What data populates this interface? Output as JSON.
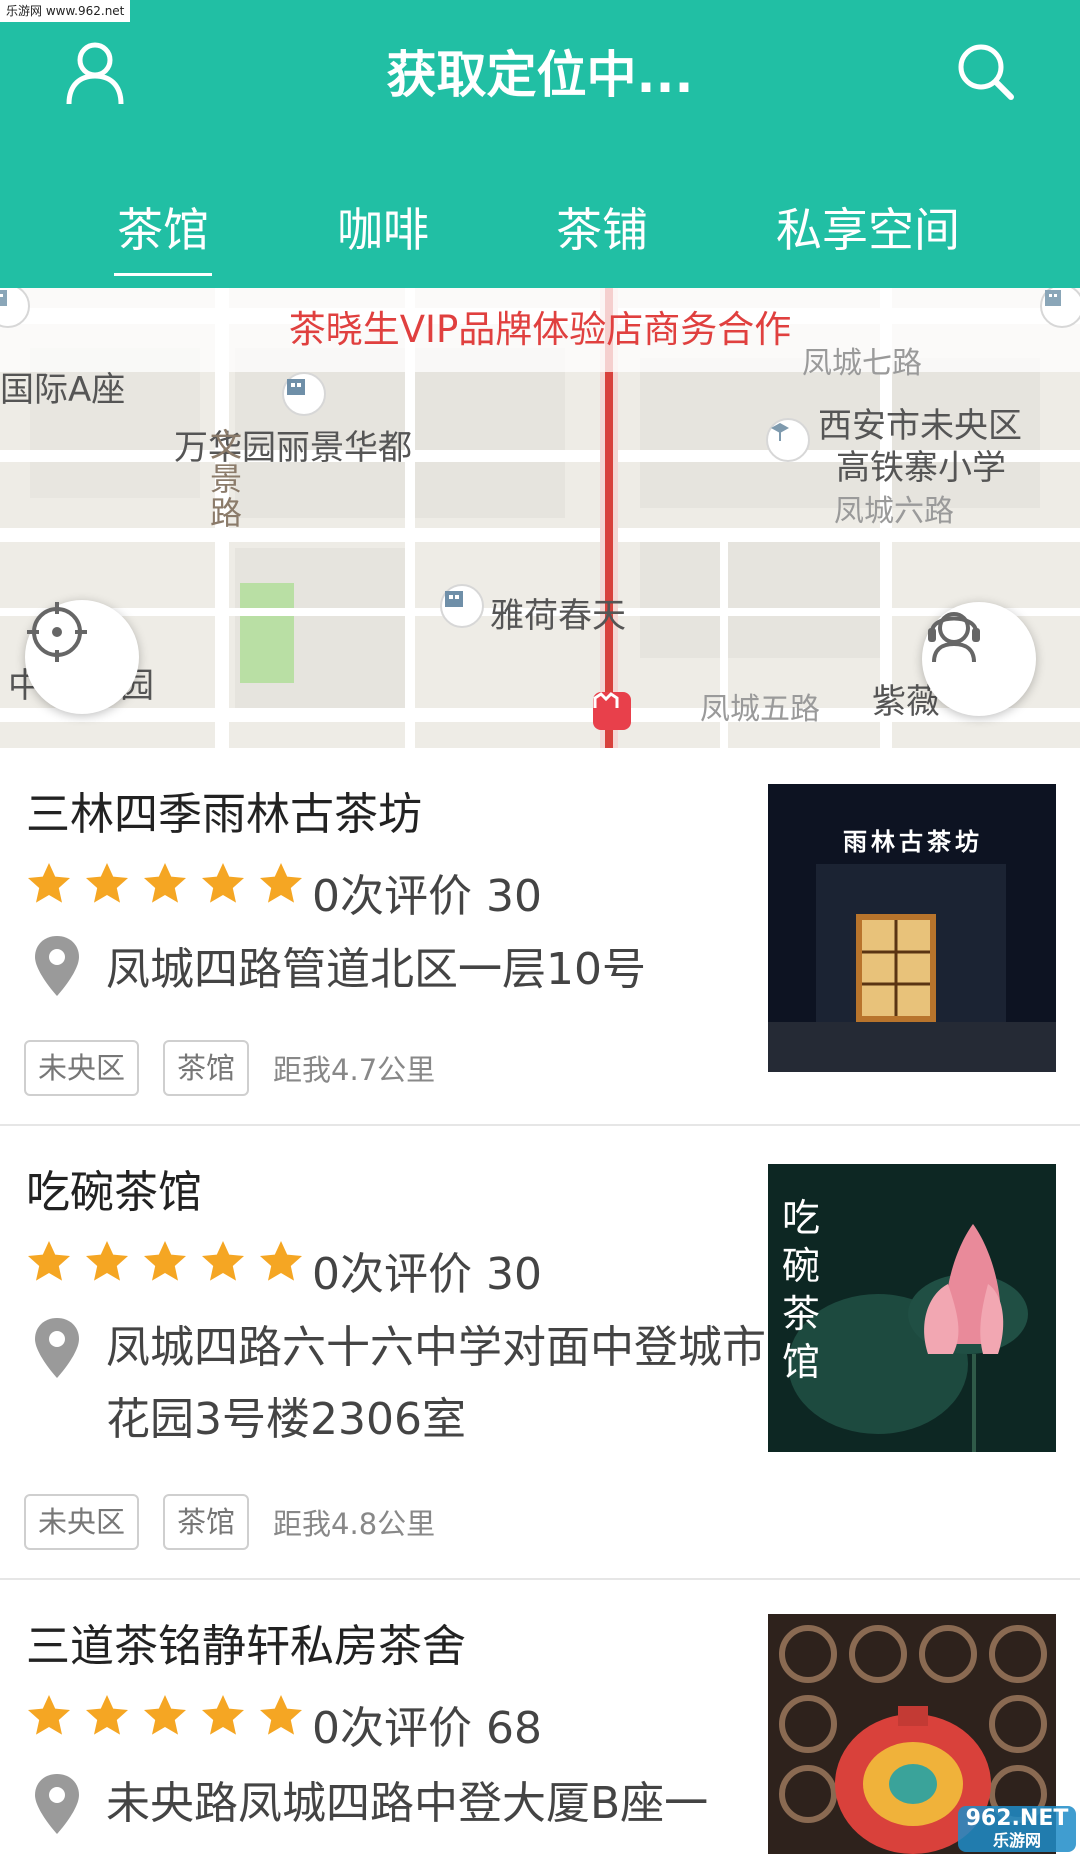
{
  "watermark": {
    "top": "乐游网 www.962.net",
    "bottom_logo": "962.NET",
    "bottom_sub": "乐游网"
  },
  "header": {
    "title": "获取定位中...",
    "user_icon": "user-icon",
    "search_icon": "search-icon",
    "background": "#21bfa4"
  },
  "tabs": [
    {
      "label": "茶馆",
      "active": true
    },
    {
      "label": "咖啡",
      "active": false
    },
    {
      "label": "茶铺",
      "active": false
    },
    {
      "label": "私享空间",
      "active": false
    }
  ],
  "map": {
    "banner": "茶晓生VIP品牌体验店商务合作",
    "labels": {
      "intl_a": "国际A座",
      "wanhua": "万华园丽景华都",
      "school_1": "西安市未央区",
      "school_2": "高铁寨小学",
      "fengcheng7": "凤城七路",
      "fengcheng6": "凤城六路",
      "wenjing": "文景路",
      "yahe": "雅荷春天",
      "fengcheng5": "凤城五路",
      "ziwei": "紫薇",
      "zhong": "中",
      "yuan": "园"
    },
    "locate_icon": "locate-icon",
    "service_icon": "headset-icon"
  },
  "shops": [
    {
      "name": "三林四季雨林古茶坊",
      "rating": 5,
      "reviews": "0次评价",
      "price": "30",
      "address": "凤城四路管道北区一层10号",
      "tags": [
        "未央区",
        "茶馆"
      ],
      "distance": "距我4.7公里",
      "image_sign": "雨林古茶坊"
    },
    {
      "name": "吃碗茶馆",
      "rating": 5,
      "reviews": "0次评价",
      "price": "30",
      "address": "凤城四路六十六中学对面中登城市花园3号楼2306室",
      "tags": [
        "未央区",
        "茶馆"
      ],
      "distance": "距我4.8公里",
      "image_sign": "吃碗茶馆"
    },
    {
      "name": "三道茶铭静轩私房茶舍",
      "rating": 5,
      "reviews": "0次评价",
      "price": "68",
      "address": "未央路凤城四路中登大厦B座一",
      "tags": [],
      "distance": "",
      "image_sign": ""
    }
  ],
  "colors": {
    "accent": "#21bfa4",
    "star": "#f5a623",
    "banner_text": "#e0403f"
  }
}
